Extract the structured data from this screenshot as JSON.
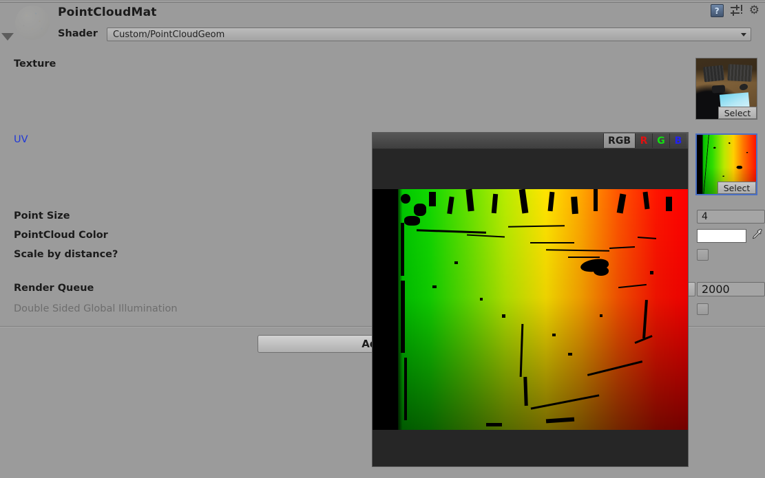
{
  "header": {
    "material_name": "PointCloudMat",
    "shader_label": "Shader",
    "shader_value": "Custom/PointCloudGeom",
    "icons": {
      "help": "help-icon",
      "help_glyph": "?",
      "preset": "preset-icon",
      "gear": "gear-icon",
      "gear_glyph": "⚙"
    }
  },
  "properties": {
    "texture": {
      "label": "Texture",
      "select_label": "Select"
    },
    "uv": {
      "label": "UV",
      "select_label": "Select"
    },
    "point_size": {
      "label": "Point Size",
      "value": "4"
    },
    "pointcloud_color": {
      "label": "PointCloud Color",
      "value_hex": "#ffffff"
    },
    "scale_by_distance": {
      "label": "Scale by distance?",
      "checked": false
    },
    "render_queue": {
      "label": "Render Queue",
      "value": "2000"
    },
    "double_sided_gi": {
      "label": "Double Sided Global Illumination",
      "checked": false
    }
  },
  "footer": {
    "add_component_label": "Add Co"
  },
  "preview": {
    "channels": [
      {
        "id": "rgb",
        "label": "RGB",
        "active": true,
        "color": "#1c1c1c"
      },
      {
        "id": "r",
        "label": "R",
        "active": false,
        "color": "#e01010"
      },
      {
        "id": "g",
        "label": "G",
        "active": false,
        "color": "#12e012"
      },
      {
        "id": "b",
        "label": "B",
        "active": false,
        "color": "#2222ee"
      }
    ]
  },
  "colors": {
    "panel_bg": "#9b9b9b",
    "label_text": "#1b1b1b",
    "link_text": "#1f38d8",
    "disabled_text": "#6d6d6d",
    "preview_bg": "#262626",
    "selection_border": "#4a6fc4"
  }
}
